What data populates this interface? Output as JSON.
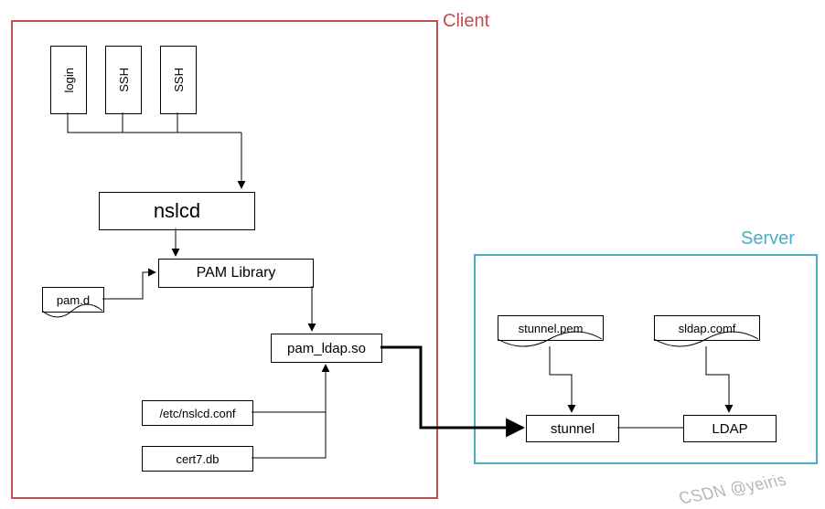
{
  "regions": {
    "client": "Client",
    "server": "Server"
  },
  "nodes": {
    "login": "login",
    "ssh1": "SSH",
    "ssh2": "SSH",
    "nslcd": "nslcd",
    "pamlib": "PAM Library",
    "pamd": "pam.d",
    "pamldap": "pam_ldap.so",
    "nslcdconf": "/etc/nslcd.conf",
    "cert7": "cert7.db",
    "stunnelpem": "stunnel.pem",
    "sldapconf": "sldap.comf",
    "stunnel": "stunnel",
    "ldap": "LDAP"
  },
  "watermark": "CSDN @yeiris",
  "chart_data": {
    "type": "diagram",
    "title": "LDAP authentication via nslcd / PAM over stunnel",
    "regions": [
      {
        "id": "client",
        "label": "Client",
        "color": "#c0504d"
      },
      {
        "id": "server",
        "label": "Server",
        "color": "#4bacc6"
      }
    ],
    "nodes": [
      {
        "id": "login",
        "label": "login",
        "region": "client",
        "kind": "process"
      },
      {
        "id": "ssh1",
        "label": "SSH",
        "region": "client",
        "kind": "process"
      },
      {
        "id": "ssh2",
        "label": "SSH",
        "region": "client",
        "kind": "process"
      },
      {
        "id": "nslcd",
        "label": "nslcd",
        "region": "client",
        "kind": "process"
      },
      {
        "id": "pamlib",
        "label": "PAM Library",
        "region": "client",
        "kind": "process"
      },
      {
        "id": "pamd",
        "label": "pam.d",
        "region": "client",
        "kind": "file"
      },
      {
        "id": "pamldap",
        "label": "pam_ldap.so",
        "region": "client",
        "kind": "module"
      },
      {
        "id": "nslcdconf",
        "label": "/etc/nslcd.conf",
        "region": "client",
        "kind": "file"
      },
      {
        "id": "cert7",
        "label": "cert7.db",
        "region": "client",
        "kind": "file"
      },
      {
        "id": "stunnelpem",
        "label": "stunnel.pem",
        "region": "server",
        "kind": "file"
      },
      {
        "id": "sldapconf",
        "label": "sldap.comf",
        "region": "server",
        "kind": "file"
      },
      {
        "id": "stunnel",
        "label": "stunnel",
        "region": "server",
        "kind": "process"
      },
      {
        "id": "ldap",
        "label": "LDAP",
        "region": "server",
        "kind": "process"
      }
    ],
    "edges": [
      {
        "from": "login",
        "to": "nslcd",
        "directed": true
      },
      {
        "from": "ssh1",
        "to": "nslcd",
        "directed": true
      },
      {
        "from": "ssh2",
        "to": "nslcd",
        "directed": true
      },
      {
        "from": "nslcd",
        "to": "pamlib",
        "directed": true
      },
      {
        "from": "pamd",
        "to": "pamlib",
        "directed": true
      },
      {
        "from": "pamlib",
        "to": "pamldap",
        "directed": true
      },
      {
        "from": "nslcdconf",
        "to": "pamldap",
        "directed": true
      },
      {
        "from": "cert7",
        "to": "pamldap",
        "directed": true
      },
      {
        "from": "pamldap",
        "to": "stunnel",
        "directed": true,
        "bold": true
      },
      {
        "from": "stunnelpem",
        "to": "stunnel",
        "directed": true
      },
      {
        "from": "sldapconf",
        "to": "ldap",
        "directed": true
      },
      {
        "from": "stunnel",
        "to": "ldap",
        "directed": false
      }
    ]
  }
}
